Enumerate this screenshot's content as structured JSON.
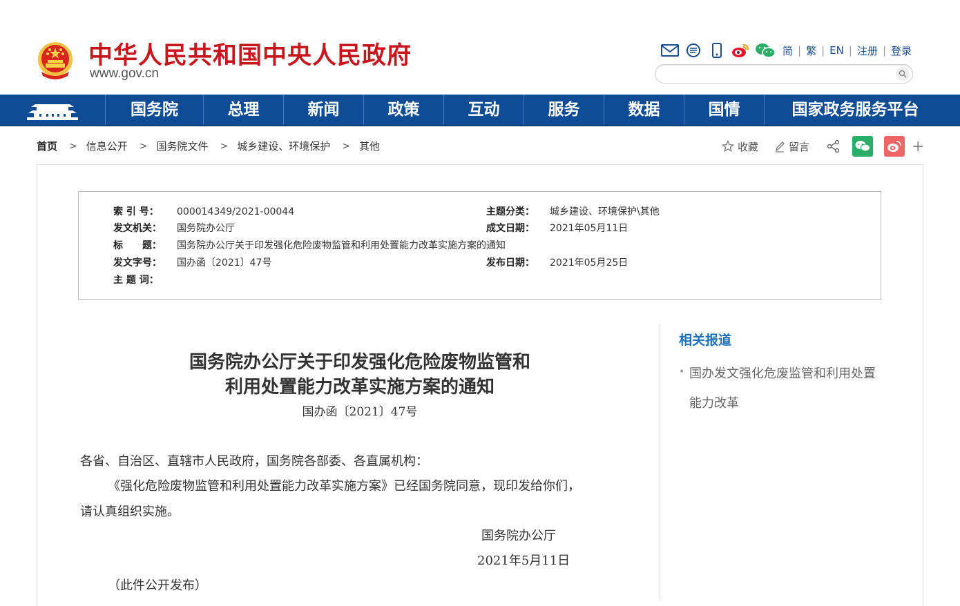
{
  "header": {
    "site_title": "中华人民共和国中央人民政府",
    "site_url": "www.gov.cn",
    "toolbar_icons": [
      "mail-icon",
      "message-icon",
      "mobile-icon",
      "weibo-icon",
      "wechat-icon"
    ],
    "links": [
      "简",
      "繁",
      "EN",
      "注册",
      "登录"
    ],
    "search_placeholder": ""
  },
  "nav": {
    "items": [
      "国务院",
      "总理",
      "新闻",
      "政策",
      "互动",
      "服务",
      "数据",
      "国情",
      "国家政务服务平台"
    ]
  },
  "breadcrumb": [
    "首页",
    "信息公开",
    "国务院文件",
    "城乡建设、环境保护",
    "其他"
  ],
  "share": {
    "collect": "收藏",
    "comment": "留言",
    "plus": "+",
    "colors": {
      "wechat": "#2aae67",
      "weibo": "#ef6464"
    }
  },
  "meta": {
    "index_label": "索 引 号：",
    "index_value": "000014349/2021-00044",
    "topic_label": "主题分类：",
    "topic_value": "城乡建设、环境保护\\其他",
    "issuer_label": "发文机关：",
    "issuer_value": "国务院办公厅",
    "date_label": "成文日期：",
    "date_value": "2021年05月11日",
    "title_label": "标　　题：",
    "title_value": "国务院办公厅关于印发强化危险废物监管和利用处置能力改革实施方案的通知",
    "docno_label": "发文字号：",
    "docno_value": "国办函〔2021〕47号",
    "pub_label": "发布日期：",
    "pub_value": "2021年05月25日",
    "keywords_label": "主 题 词：",
    "keywords_value": ""
  },
  "article": {
    "title_line1": "国务院办公厅关于印发强化危险废物监管和",
    "title_line2": "利用处置能力改革实施方案的通知",
    "doc_no": "国办函〔2021〕47号",
    "salutation": "各省、自治区、直辖市人民政府，国务院各部委、各直属机构：",
    "body_line1": "《强化危险废物监管和利用处置能力改革实施方案》已经国务院同意，现印发给你们，",
    "body_line2": "请认真组织实施。",
    "signer": "国务院办公厅",
    "sign_date": "2021年5月11日",
    "public_note": "（此件公开发布）"
  },
  "sidebar": {
    "title": "相关报道",
    "items": [
      "国办发文强化危废监管和利用处置能力改革"
    ]
  }
}
